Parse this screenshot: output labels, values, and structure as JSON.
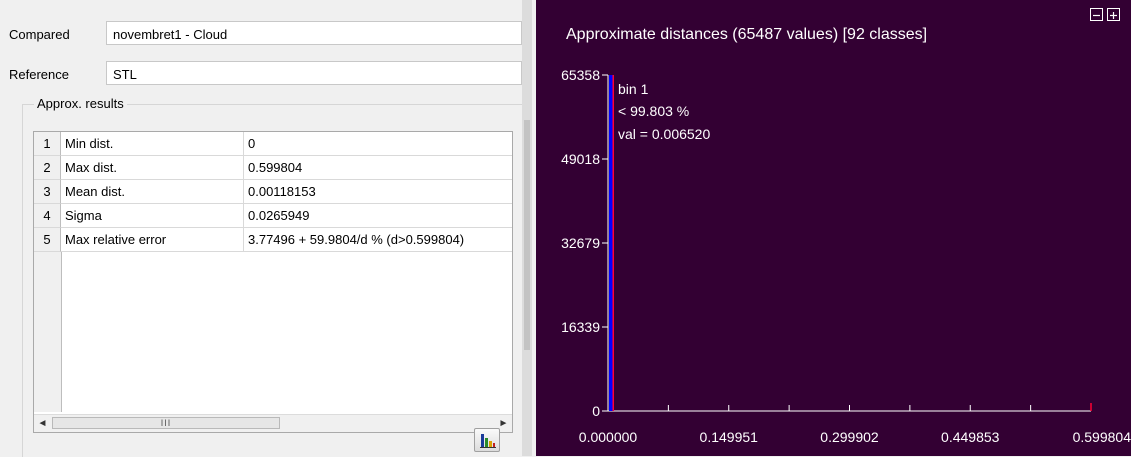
{
  "compared": {
    "label": "Compared",
    "value": "novembret1 - Cloud"
  },
  "reference": {
    "label": "Reference",
    "value": "STL"
  },
  "results": {
    "title": "Approx. results",
    "rows": [
      {
        "num": "1",
        "name": "Min dist.",
        "value": "0"
      },
      {
        "num": "2",
        "name": "Max dist.",
        "value": "0.599804"
      },
      {
        "num": "3",
        "name": "Mean dist.",
        "value": "0.00118153"
      },
      {
        "num": "4",
        "name": "Sigma",
        "value": "0.0265949"
      },
      {
        "num": "5",
        "name": "Max relative error",
        "value": "3.77496 + 59.9804/d % (d>0.599804)"
      }
    ],
    "scroll_left": "◄",
    "scroll_right": "►",
    "scroll_thumb": "III"
  },
  "histogram_button": {
    "icon": "histogram-icon"
  },
  "plot": {
    "title": "Approximate distances (65487 values) [92 classes]",
    "collapse_icon": "minus-box-icon",
    "expand_icon": "plus-box-icon",
    "tooltip": {
      "line1": "bin 1",
      "line2": "< 99.803 %",
      "line3": "val = 0.006520"
    }
  },
  "chart_data": {
    "type": "bar",
    "title": "Approximate distances (65487 values) [92 classes]",
    "xlim": [
      0.0,
      0.599804
    ],
    "ylim": [
      0,
      65358
    ],
    "x_ticks": [
      "0.000000",
      "0.149951",
      "0.299902",
      "0.449853",
      "0.599804"
    ],
    "y_ticks": [
      "0",
      "16339",
      "32679",
      "49018",
      "65358"
    ],
    "bins": [
      {
        "x": 0.00652,
        "count": 65358
      }
    ],
    "colors": {
      "background": "#330033",
      "bar": "#0000ff",
      "highlight": "#ff0033",
      "axis": "#ffffff"
    }
  }
}
